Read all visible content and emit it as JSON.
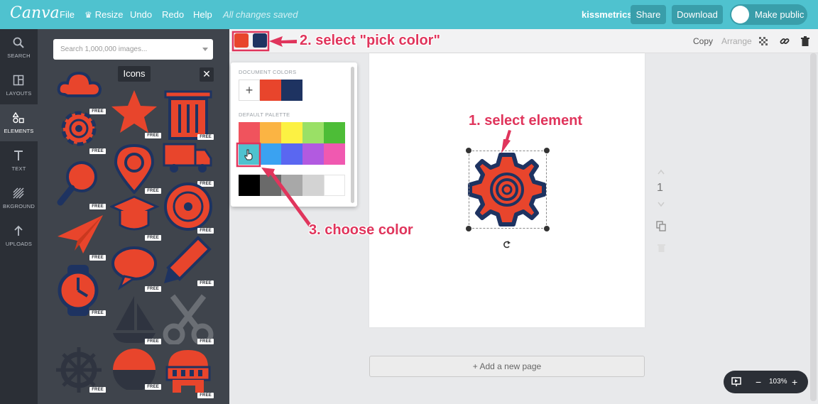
{
  "topbar": {
    "logo": "Canva",
    "menu": {
      "file": "File",
      "resize": "Resize",
      "undo": "Undo",
      "redo": "Redo",
      "help": "Help",
      "saved": "All changes saved"
    },
    "brand": "kissmetrics",
    "share": "Share",
    "download": "Download",
    "make_public": "Make public"
  },
  "rail": {
    "search": "SEARCH",
    "layouts": "LAYOUTS",
    "elements": "ELEMENTS",
    "text": "TEXT",
    "bkground": "BKGROUND",
    "uploads": "UPLOADS"
  },
  "panel": {
    "search_placeholder": "Search 1,000,000 images...",
    "tooltip": "Icons",
    "close": "✕",
    "badge": "FREE"
  },
  "subbar": {
    "copy": "Copy",
    "arrange": "Arrange"
  },
  "picker": {
    "document_colors_label": "DOCUMENT COLORS",
    "default_palette_label": "DEFAULT PALETTE",
    "plus": "+",
    "document_colors": [
      "#e8452c",
      "#1e3361"
    ],
    "palette": [
      [
        "#f0535d",
        "#fbb443",
        "#fcf143",
        "#9ae066",
        "#4dbd37"
      ],
      [
        "#4fc2cf",
        "#3aa2f1",
        "#5a67f1",
        "#b25ae0",
        "#f059b0"
      ],
      [
        "#000000",
        "#6a6a6a",
        "#a8a8a8",
        "#d3d3d3",
        "#ffffff"
      ]
    ]
  },
  "page": {
    "number": "1",
    "add_page": "+ Add a new page"
  },
  "annotations": {
    "step1": "1. select element",
    "step2": "2. select \"pick color\"",
    "step3": "3. choose color"
  },
  "zoom": {
    "level": "103%",
    "minus": "−",
    "plus": "+"
  },
  "colors": {
    "accent": "#4fc2cf",
    "icon_red": "#e8452c",
    "icon_navy": "#1e3361",
    "annotation": "#e0355c"
  }
}
